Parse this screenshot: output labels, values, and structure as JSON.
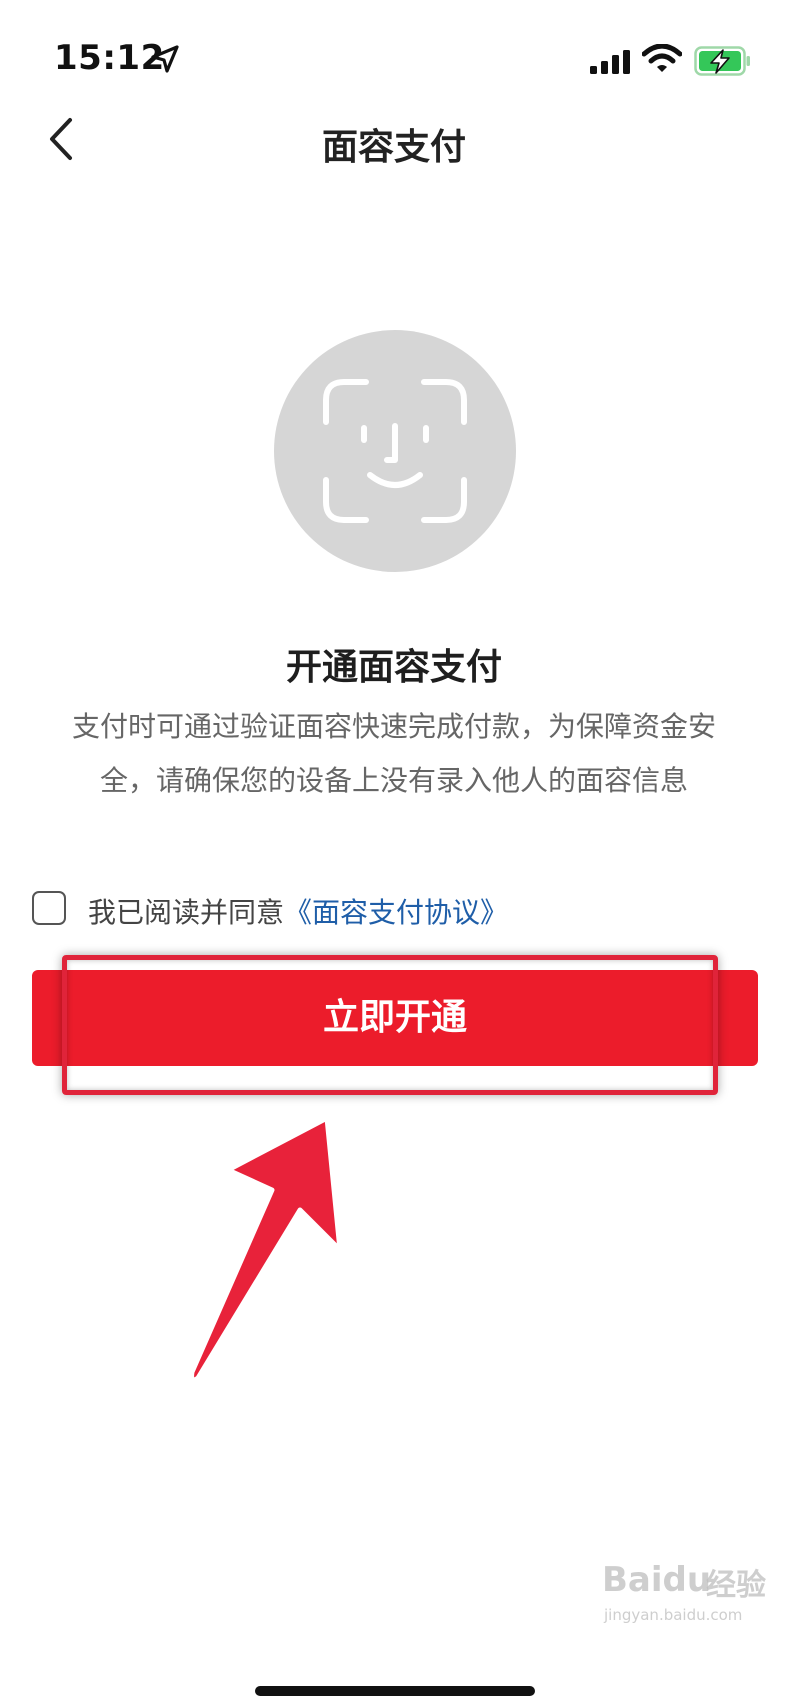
{
  "status_bar": {
    "time": "15:12",
    "icons": [
      "location-arrow-icon",
      "signal-icon",
      "wifi-icon",
      "battery-charging-icon"
    ],
    "battery_color": "#34c759"
  },
  "nav": {
    "back_icon": "chevron-left-icon",
    "title": "面容支付"
  },
  "face_icon": {
    "name": "face-id-icon",
    "circle_color": "#d6d6d6"
  },
  "content": {
    "heading": "开通面容支付",
    "description_line1": "支付时可通过验证面容快速完成付款，为保障资金安",
    "description_line2": "全，请确保您的设备上没有录入他人的面容信息"
  },
  "agreement": {
    "checked": false,
    "prefix": "我已阅读并同意",
    "link": "《面容支付协议》",
    "link_color": "#1f5ea8"
  },
  "button": {
    "label": "立即开通",
    "color": "#ec1c2b"
  },
  "annotation": {
    "highlight_color": "#e0243a",
    "arrow_color": "#e8223a"
  },
  "watermark": {
    "brand": "Baidu",
    "cn": "经验",
    "url": "jingyan.baidu.com"
  }
}
